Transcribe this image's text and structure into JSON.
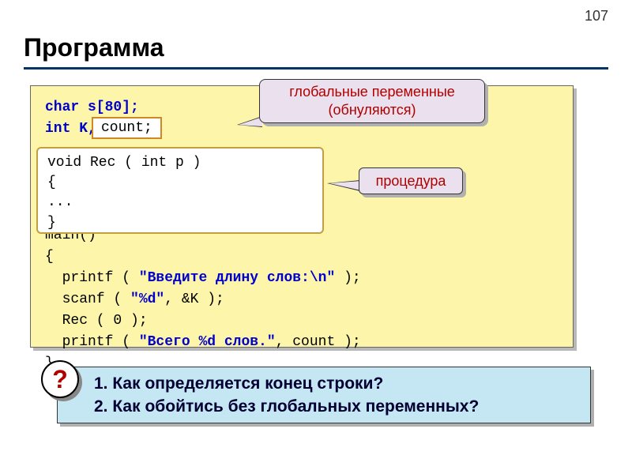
{
  "page_number": "107",
  "title": "Программа",
  "code_pre": "char s[80];\nint K, ",
  "count_fragment": "count;",
  "proc_code": "void Rec ( int p )\n{\n...\n}",
  "code_main_1": "main()",
  "code_main_2": "{",
  "code_main_3a": "  printf ( ",
  "code_main_3b": "\"Введите длину слов:\\n\"",
  "code_main_3c": " );",
  "code_main_4a": "  scanf ( ",
  "code_main_4b": "\"%d\"",
  "code_main_4c": ", &K );",
  "code_main_5": "  Rec ( 0 );",
  "code_main_6a": "  printf ( ",
  "code_main_6b": "\"Всего %d слов.\"",
  "code_main_6c": ", count );",
  "code_main_7": "}",
  "callout1_line1": "глобальные переменные",
  "callout1_line2": "(обнуляются)",
  "callout2": "процедура",
  "question1": "Как определяется конец строки?",
  "question2": "Как обойтись без глобальных переменных?",
  "q_bullet1": "1. ",
  "q_bullet2": "2. ",
  "q_mark": "?"
}
